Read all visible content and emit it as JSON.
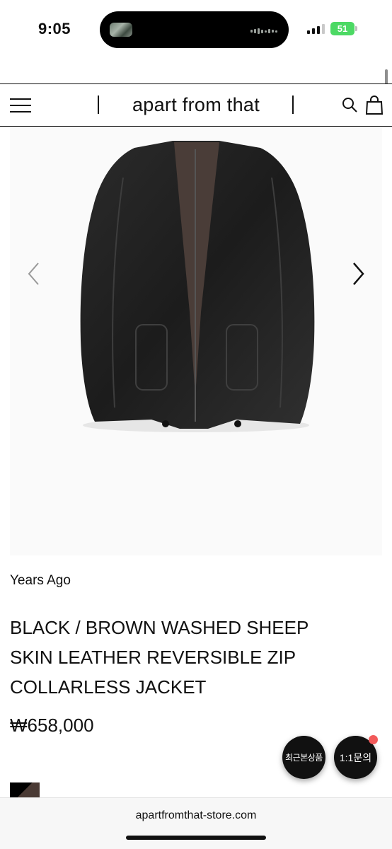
{
  "status_bar": {
    "time": "9:05",
    "battery_percent": "51",
    "icons": [
      "signal-icon",
      "battery-icon",
      "dynamic-island"
    ]
  },
  "header": {
    "site_title": "apart from that",
    "icons": [
      "menu-icon",
      "search-icon",
      "shopping-bag-icon"
    ]
  },
  "gallery": {
    "image_alt": "black leather collarless jacket",
    "icons": [
      "chevron-left-icon",
      "chevron-right-icon"
    ]
  },
  "product": {
    "brand": "Years Ago",
    "title_lines": [
      "BLACK / BROWN WASHED SHEEP",
      "SKIN LEATHER REVERSIBLE ZIP",
      "COLLARLESS JACKET"
    ],
    "price": "₩658,000",
    "swatch_colors": [
      "#000000",
      "#4a3a34"
    ]
  },
  "floating": {
    "recent_label": "최근본상품",
    "inquiry_label": "1:1문의",
    "notify_color": "#f25a5a"
  },
  "browser": {
    "url": "apartfromthat-store.com"
  },
  "colors": {
    "battery": "#4cd964",
    "text": "#111111",
    "background": "#ffffff"
  }
}
